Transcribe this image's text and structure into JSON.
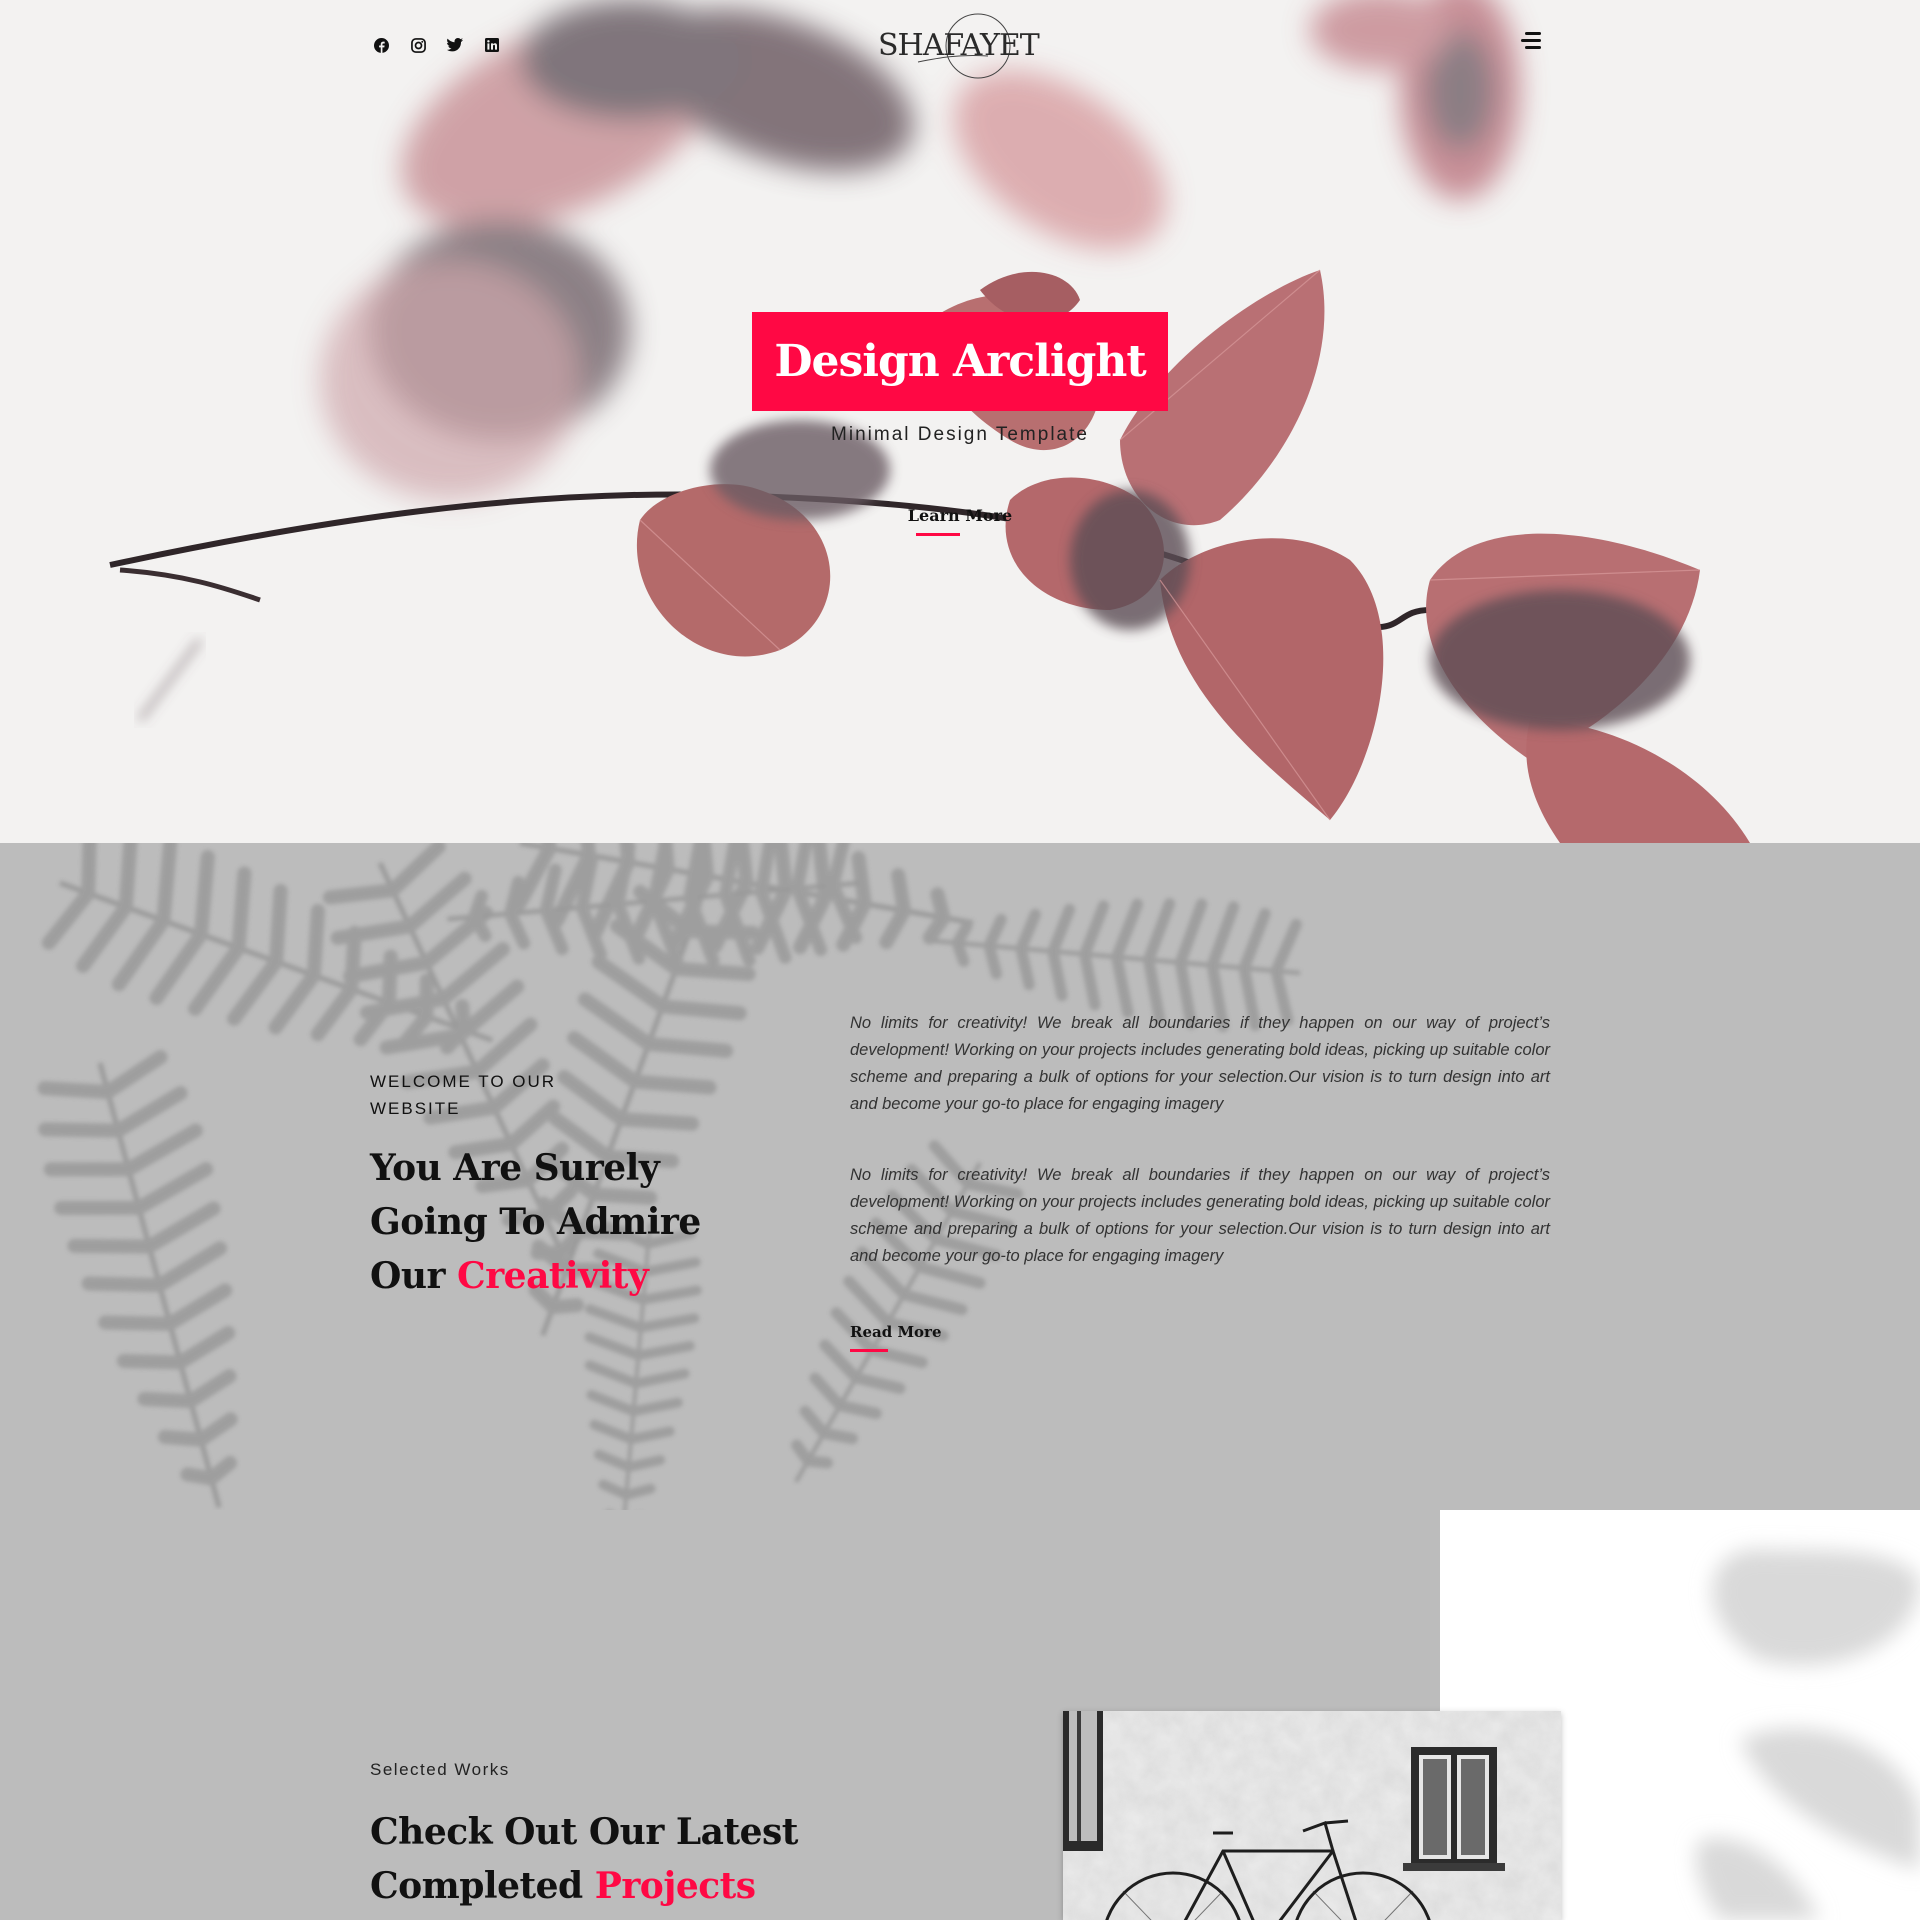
{
  "header": {
    "social": [
      "facebook-icon",
      "instagram-icon",
      "twitter-icon",
      "linkedin-icon"
    ],
    "logo_text": "SHAFAYET",
    "menu_icon": "hamburger-icon"
  },
  "hero": {
    "title": "Design Arclight",
    "subtitle": "Minimal Design Template",
    "cta": "Learn More"
  },
  "welcome": {
    "eyebrow": "WELCOME TO OUR WEBSITE",
    "heading_line": "You Are Surely Going To Admire Our",
    "heading_accent": "Creativity",
    "paragraph_1": "No limits for creativity! We break all boundaries if they happen on our way of project’s development! Working on your projects includes generating bold ideas, picking up suitable color scheme and preparing a bulk of options for your selection.Our vision is to turn design into art and become your go-to place for engaging imagery",
    "paragraph_2": "No limits for creativity! We break all boundaries if they happen on our way of project’s development! Working on your projects includes generating bold ideas, picking up suitable color scheme and preparing a bulk of options for your selection.Our vision is to turn design into art and become your go-to place for engaging imagery",
    "cta": "Read More"
  },
  "works": {
    "label": "Selected Works",
    "heading_line": "Check Out Our Latest Completed",
    "heading_accent": "Projects"
  },
  "colors": {
    "accent": "#ff0844",
    "hero_bg": "#f3f2f1",
    "section_bg": "#bcbcbc"
  }
}
